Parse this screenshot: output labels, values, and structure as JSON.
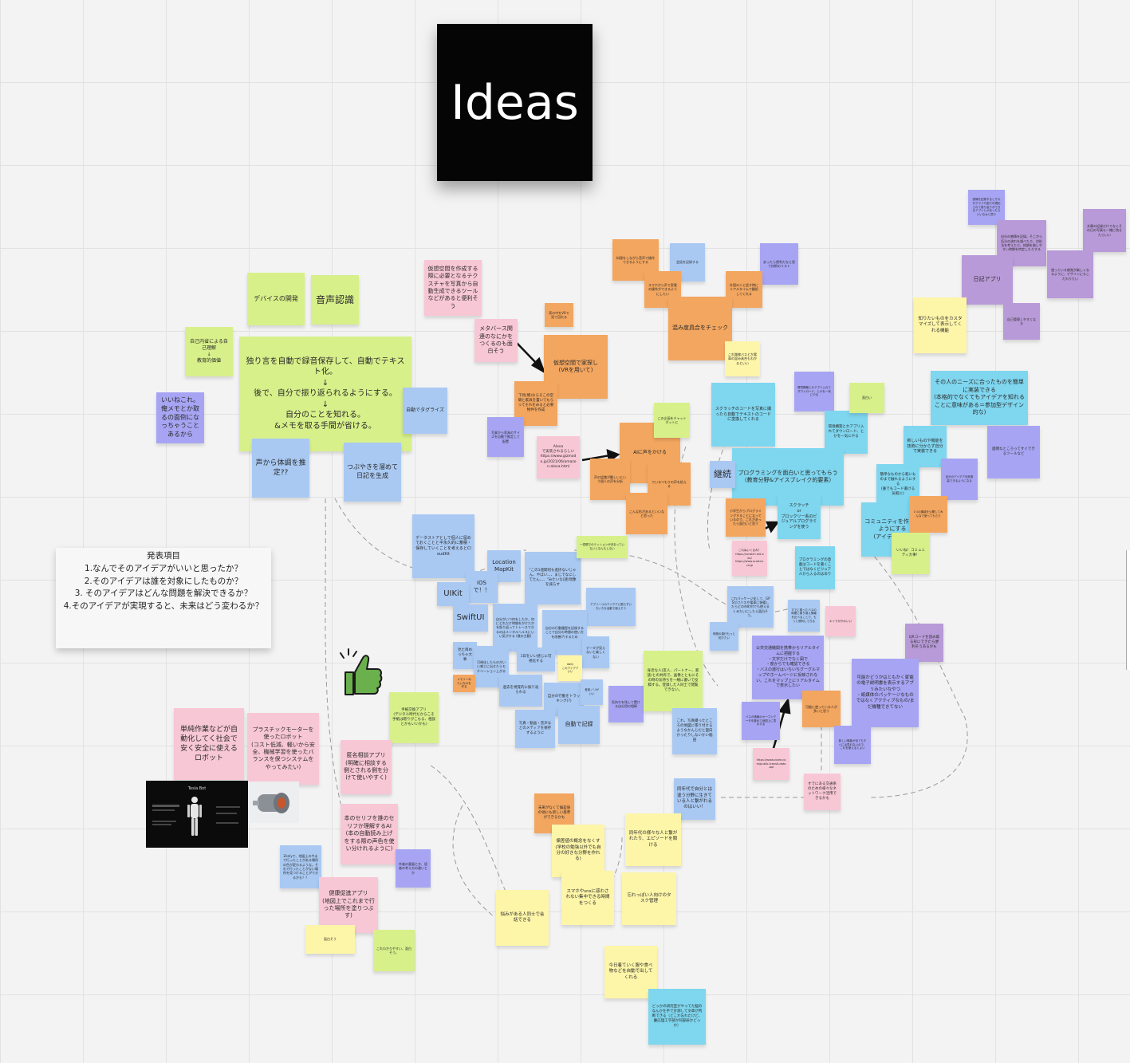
{
  "board": {
    "title": "Ideas",
    "agenda": {
      "heading": "発表項目",
      "items": [
        "1.なんでそのアイデアがいいと思ったか？",
        "2.そのアイデアは誰を対象にしたものか？",
        "3. そのアイデアはどんな問題を解決できるか？",
        "4.そのアイデアが実現すると、未来はどう変わるか？"
      ]
    },
    "notes": {
      "device_dev": "デバイスの開発",
      "speech_rec": "音声認識",
      "self_reflect": "自己内省による自己理解\n↓\n教育的価値",
      "main_idea": "独り言を自動で録音保存して、自動でテキスト化。\n↓\n後で、自分で振り返られるようにする。\n↓\n自分のことを知れる。\n&メモを取る手間が省ける。",
      "auto_tag": "自動でタグライズ",
      "memo_home": "いいねこれ。俺メモとか取るの面倒になっちゃうことあるから",
      "voice_mood": "声から体調を推定??",
      "murmur_diary": "つぶやきを溜めて日記を生成",
      "virtual_texture": "仮想空間を作成する際に必要となるテクスチャを写真から自動生成できるツールなどがあると便利そう",
      "metaverse": "メタバース関連のなにかをつくるのも面白そう",
      "virtual_house": "仮想空間で家探し\n(VRを用いて)",
      "orange_small_1": "家の中をVRで見て回れる",
      "orange_small_2": "下見(間)ならそこの空間と家具を置いてもらってそれをみると必要物件を作成",
      "purple_small_1": "写真から家具のサイズを自動で推定して配置",
      "alexa": "Alexa\nで実装されるらしい\nhttps://www.gizmodo.jp/2021/06/amazon-alexa.html",
      "ai_talk": "AIに声をかける",
      "orange_mid_1": "声の認識が難しいという個人の声を分析",
      "orange_mid_2": "でいるつもりの声を拾える",
      "orange_mid_3": "こんな形があるといいなと思った",
      "green_chat": "この企画をチャットボットに",
      "orange_top_1": "料理をしながら音声で操作できるようにする",
      "blue_top_1": "会話を記録する",
      "orange_top_2": "スマホから声で家電の操作ができるようにしたい",
      "purple_top_1": "あったら便利だなと思う技術のリスト",
      "orange_top_3": "外国の人と話す時にリアルタイムで翻訳してくれる",
      "crowd_check": "混み度具合をチェック",
      "yellow_bus": "これ路線バスとか電車の混み具合もわかるといい",
      "scratch_code": "スクラッチのコードを写真に撮ったら自動でテキストのコードに変換してくれる",
      "teach_diagram": "環境構築とかアプリ入れてダウンロード、とかを一気にやる",
      "green_tiny_1": "面白い",
      "programming_fun": "プログラミングを面白いと思ってもらう（教育分野&アイスブレイク的要素）",
      "continue": "継続",
      "needs_match": "その人のニーズに合ったものを簡単に実装できる\n(本格的でなくてもアイデアを知れることに意味がある＝参加型デザイン的な)",
      "new_tech": "新しいものや機能を技術に分からず自分で実装できる",
      "easy_tool": "簡単なものから軽いものまで触れるようにする\n(誰でもコード書ける気軽に)",
      "purple_wide_1": "面倒なところってすぐできるツールなど",
      "sophisticated": "自分のアイデアを即実装できるようになる",
      "scratch_block": "スクラッチ\nor\nブロックリー系のビジュアルプログラミングを使う",
      "orange_prog": "小学生からプログラミングすることになっているので、これがあったら面白いと思う",
      "community": "コミュニティを作れるようにする\n(アイデア共有)",
      "orange_right": "1つの機能を公開してみんなで使ってもらう",
      "green_community": "いいね！コミュニティ大事！",
      "prog_pink": "これぬいぐるみ？\nhttps://scratch.mit.edu/\nhttps://www.scratch.co.jp",
      "prog_visual": "プログラミングの意義はコードを書くことではなくビジュアルから入るのはあり",
      "data_store": "データストアとして個人に留めておくことと半永久的に蓄積・保存していくことを考えるとCloudKit",
      "location_kit": "Location\nMapKit",
      "ios": "iOSで！！",
      "uikit": "UIKit",
      "swiftui": "SwiftUI",
      "quote_idea": "\"この1週間何も進捗ないじゃん、やばい、、、まじでなにしてたん、、、\"みたいな(謎)現象を減らす",
      "green_side": "一週間でのミッションが決まっていないとなんもしない",
      "blue_unused": "アプリ一つのアイデアに限らずいろいろな活動で使えそう",
      "track_self": "自分がいつ何をしたか、何にどれだけ時間をかけたかを振り返ってトレースできるのはメンタルヘルスにいい気がする\n(僕の主観)",
      "blue_tasks": "自分の行動履歴を記録することで自分の時間の使い方を改善(?)するため",
      "look_back": "見た目めっちゃ大事",
      "blue_viz": "可視化したものがいい感じに出せたらモチベーション上がる",
      "data_small": "データが見えないと楽しくない",
      "one_day": "1日をいい感じに可視化する",
      "yellow_tiny": "daily\nこのアイデアいい",
      "past_look": "過去を視覚的に振り返られる",
      "daily_track": "自分の行動をトラッキング(?)",
      "photo_media": "写真・動画・音声などのメディアを保存するように",
      "auto_record": "自動で記録",
      "yellow_time": "音楽ノリがいい",
      "orange_small_2b": "メモリーみたいなのを作る",
      "purple_sync": "気持ちを残して置ける自分用の相棒",
      "family": "身近な人(友人、パートナー、家族)との共有で、画像とともにその時の気持ちを一緒に書いて投稿する。登録した人同士で閲覧できない。",
      "photo_place": "これ、写真撮ったところの地図に張り付けるようなかんじだと面白かったりしないかい稲田",
      "public_transport": "公共交通機関を携帯からリアルタイムに把握する\n・文字だけでなく図で\n・度からでも確認できる\n・バスの運行はいちいちグーグルマップやホームページに反映されない。これをマップ上にリアルタイムで表示したい",
      "purple_bus": "バスの情報のオープンデータを集めて地図上に表示する",
      "bus_link": "https://www.claire.com/public-transit-data-api",
      "pink_bus_small": "タップした場所のバス情報",
      "orange_bus": "可能に使っている人が多いと思う",
      "public_network": "すでにある交通系のための様々なネットワーク活用できるかも",
      "qr_code": "QRコードを読み取る形にできたら便利そうあるかも",
      "appliance": "可能かどうかはともかく家電の電子説明書を表示するアプリみたいなやつ\n・紙媒体のパッケージなものではなくアクティブなもの/まだ機種できてない",
      "purple_small_r1": "新しい機能が出てもすぐには見れないので、これを使えるとよい",
      "blue_small_r1": "タップ時の詳細はもっと知りたい",
      "pink_small_r1": "キャラがかわいい",
      "blue_bus_app": "すでに乗ったバスの時間と乗り換え情報を比べることで、もっと便利にできる",
      "blue_tiny_r1": "夜間の運行もっと知りたい",
      "gps_bus": "これパッケージ化して、GPSだけバスや電車に装備したらどの市町村でも使えるくみたいにしたら面白そう。",
      "diary_app": "日記アプリ",
      "purple_r1": "感情を記録するとそれがグラフや図で可視化されて振り返りができるアプリとかあったらいいなぁと思う",
      "purple_r2": "自分の感情を記録。そこから気分の流れを調べたり、対処法を考えたり、体調を崩しやすい時期を特定したりする",
      "purple_r3": "文章の記録だけでなくその日の写真も一緒に残せたらいい",
      "purple_r4": "使っている感覚が楽しくなるように、デザインにもこだわりたい",
      "purple_r5": "自己管理しやすくなる",
      "yellow_custom": "知りたいものをカスタマイズして表示してくれる機能",
      "green_mutual": "手紙交換アプリ\n(デジタル時代だからこそ手紙は贈りがこもる、相談とかもいいかも)",
      "anon_consult": "匿名相談アプリ\n(明確に相談する側とされる側を分けて使いやすく)",
      "book_ai": "本のセリフを誰のセリフか理解するAI\n(本の自動読み上げをする際の声色を使い分けれるように)",
      "purple_bottom": "作者の意図とか、読者の考え方の違いとか",
      "blue_bottom_small": "Zenlyで、地図上の今まで行ったことがある場所の色が変わるような。それで行ったことがない場所を見つけることができるかも？？",
      "health_app": "健康促進アプリ\n(地図上でこれまで行った場所を塗りつぶす)",
      "yellow_bottom_left": "面白そう",
      "green_bottom": "これわかりやすい、面白そう。",
      "auto_robot": "単純作業などが自動化してく社会で安く安全に使えるロボット",
      "plastic_motor": "プラスチックモーターを使ったロボット\n(コスト低減、軽いから安全、機械学習を使ったバランスを保つシステムをやってみたい)",
      "robot_slide_title": "Tesla Bot",
      "grade_think": "同年代で自分とは違う分野に生きている人と繋がれるのはいい！",
      "deviation": "偏差値の概念をなくす(学校の勉強以外でも自分の好きな分野を作れる)",
      "orange_bottom": "未来がなくて偏差値の他にも新しい基準ができるかも",
      "same_age": "同年代の様々な人と繋がれたり、エピソードを聞ける",
      "worry_talk": "悩みがある人同士で会話できる",
      "sns_focus": "スマホやsnsに惑わされない集中できる時間をつくる",
      "forget_task": "忘れっぽい人向けのタスク管理",
      "house_rec": "今日着ていく服や食べ物などを自動で出してくれる",
      "lab_rec": "どっかの研究室がやってた脳のなんかを手で計測して文章が判断できる（どこか忘れたけど、慶応理工学部か阿部研かどっか）"
    }
  }
}
